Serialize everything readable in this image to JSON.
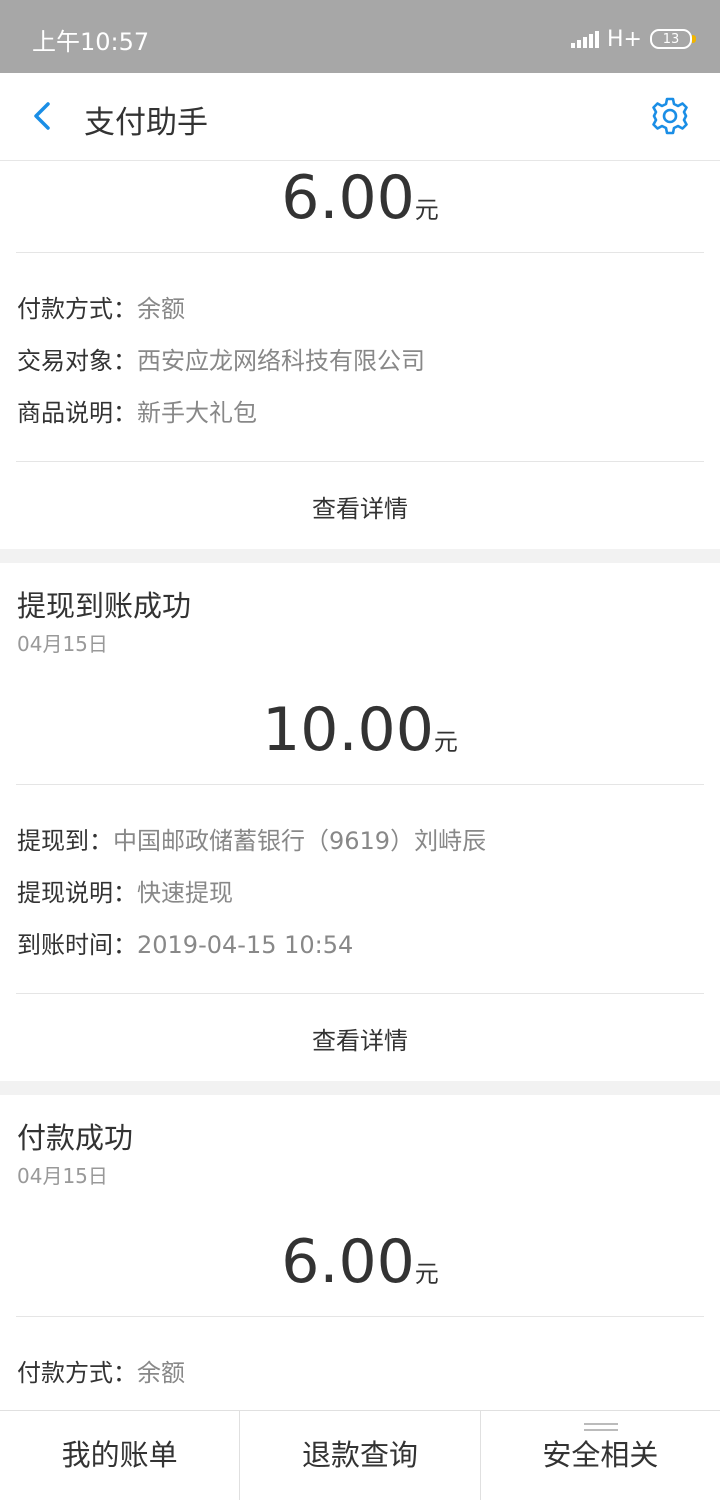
{
  "status_bar": {
    "time": "上午10:57",
    "network": "H+",
    "battery": "13"
  },
  "header": {
    "title": "支付助手"
  },
  "cards": [
    {
      "amount": "6.00",
      "unit": "元",
      "rows": [
        {
          "label": "付款方式：",
          "value": "余额"
        },
        {
          "label": "交易对象：",
          "value": "西安应龙网络科技有限公司"
        },
        {
          "label": "商品说明：",
          "value": "新手大礼包"
        }
      ],
      "detail_label": "查看详情"
    },
    {
      "title": "提现到账成功",
      "date": "04月15日",
      "amount": "10.00",
      "unit": "元",
      "rows": [
        {
          "label": "提现到：",
          "value": "中国邮政储蓄银行（9619）刘峙辰"
        },
        {
          "label": "提现说明：",
          "value": "快速提现"
        },
        {
          "label": "到账时间：",
          "value": "2019-04-15 10:54"
        }
      ],
      "detail_label": "查看详情"
    },
    {
      "title": "付款成功",
      "date": "04月15日",
      "amount": "6.00",
      "unit": "元",
      "rows": [
        {
          "label": "付款方式：",
          "value": "余额"
        }
      ]
    }
  ],
  "tabs": [
    {
      "label": "我的账单"
    },
    {
      "label": "退款查询"
    },
    {
      "label": "安全相关"
    }
  ],
  "colors": {
    "accent": "#1a8ee6",
    "status_bar": "#a7a7a7",
    "background": "#f2f2f2"
  }
}
